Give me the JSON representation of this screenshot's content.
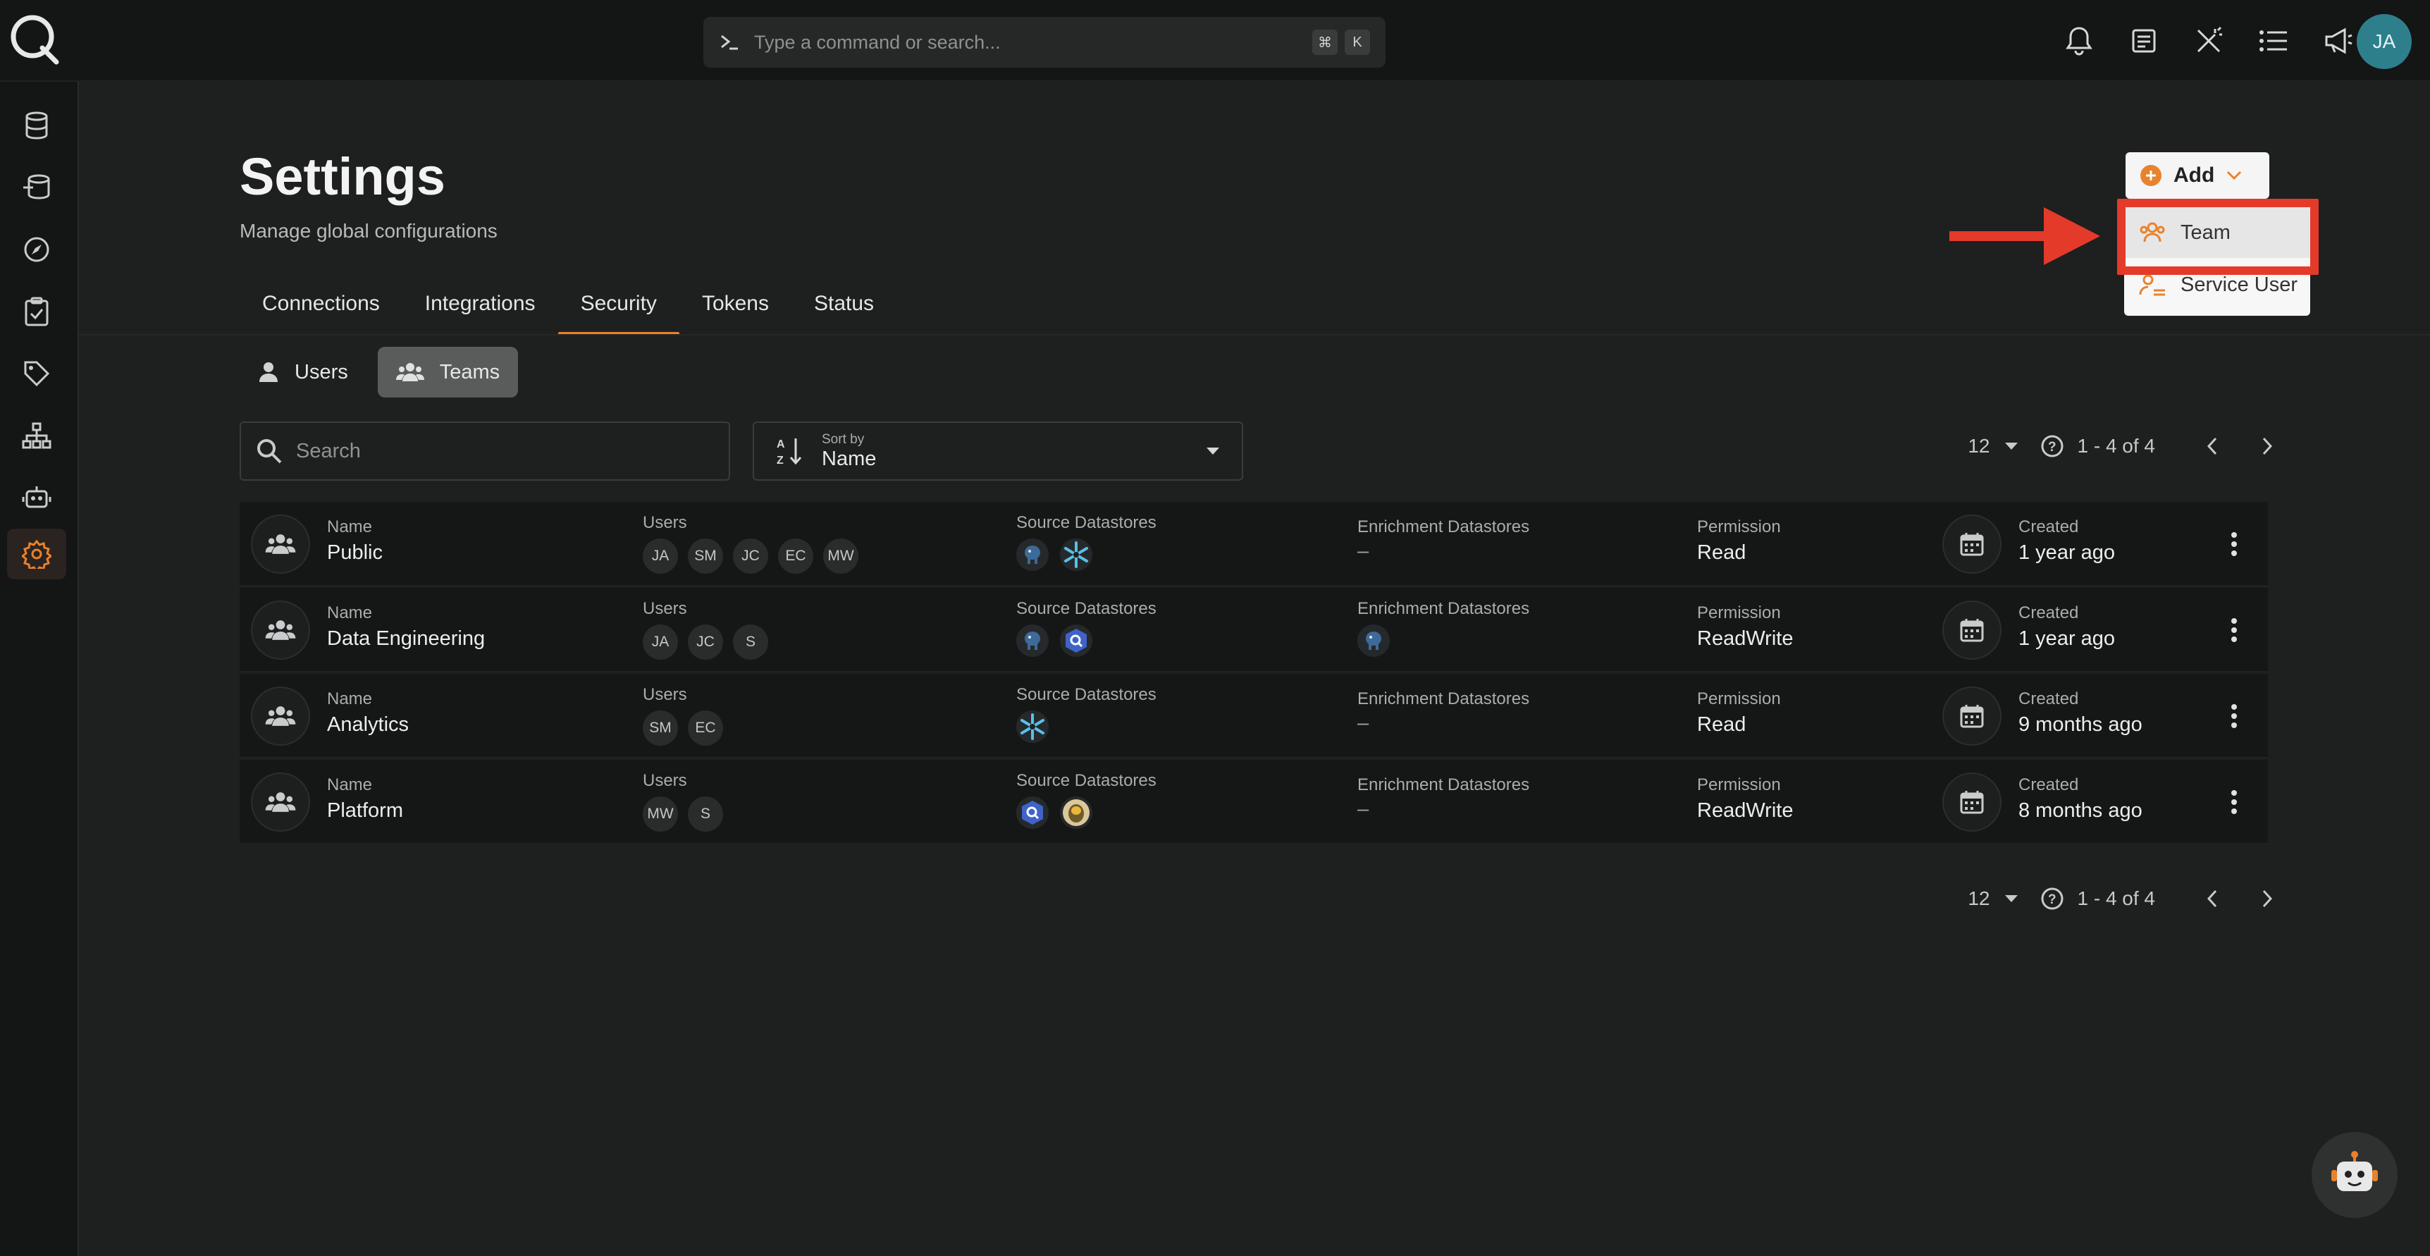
{
  "command": {
    "placeholder": "Type a command or search...",
    "k1": "⌘",
    "k2": "K"
  },
  "user": {
    "initials": "JA"
  },
  "page": {
    "title": "Settings",
    "subtitle": "Manage global configurations"
  },
  "tabs": [
    "Connections",
    "Integrations",
    "Security",
    "Tokens",
    "Status"
  ],
  "active_tab": "Security",
  "segments": {
    "users": "Users",
    "teams": "Teams",
    "active": "Teams"
  },
  "search": {
    "placeholder": "Search"
  },
  "sort": {
    "label": "Sort by",
    "value": "Name"
  },
  "pagination": {
    "per_page": "12",
    "range": "1 - 4 of 4"
  },
  "columns": {
    "name": "Name",
    "users": "Users",
    "source": "Source Datastores",
    "enrichment": "Enrichment Datastores",
    "permission": "Permission",
    "created": "Created"
  },
  "rows": [
    {
      "name": "Public",
      "users": [
        "JA",
        "SM",
        "JC",
        "EC",
        "MW"
      ],
      "source": [
        "postgres-icon",
        "snowflake-icon"
      ],
      "enrichment": "–",
      "permission": "Read",
      "created": "1 year ago"
    },
    {
      "name": "Data Engineering",
      "users": [
        "JA",
        "JC",
        "S"
      ],
      "source": [
        "postgres-icon",
        "bigquery-icon"
      ],
      "enrichment": [
        "postgres-icon"
      ],
      "permission": "ReadWrite",
      "created": "1 year ago"
    },
    {
      "name": "Analytics",
      "users": [
        "SM",
        "EC"
      ],
      "source": [
        "snowflake-icon"
      ],
      "enrichment": "–",
      "permission": "Read",
      "created": "9 months ago"
    },
    {
      "name": "Platform",
      "users": [
        "MW",
        "S"
      ],
      "source": [
        "bigquery-icon",
        "hive-icon"
      ],
      "enrichment": "–",
      "permission": "ReadWrite",
      "created": "8 months ago"
    }
  ],
  "add_menu": {
    "button": "Add",
    "items": [
      "Team",
      "Service User"
    ]
  },
  "colors": {
    "accent": "#e9822c",
    "highlight": "#e43a2a",
    "avatar": "#2d7f8c"
  }
}
